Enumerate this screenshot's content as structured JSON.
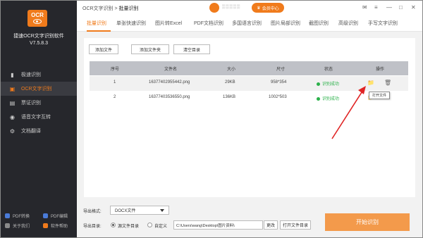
{
  "app": {
    "name": "捷速OCR文字识别软件",
    "version": "V7.5.8.3"
  },
  "sidebar": {
    "items": [
      {
        "label": "极速识别",
        "icon": "bookmark-icon"
      },
      {
        "label": "OCR文字识别",
        "icon": "ocr-icon",
        "active": true
      },
      {
        "label": "票证识别",
        "icon": "ticket-icon"
      },
      {
        "label": "语音文字互转",
        "icon": "voice-icon"
      },
      {
        "label": "文档翻译",
        "icon": "translate-icon"
      }
    ],
    "bottom_links": [
      {
        "label": "PDF转换",
        "color": "#4a7bd8"
      },
      {
        "label": "PDF编辑",
        "color": "#4a7bd8"
      },
      {
        "label": "关于我们",
        "color": "#8a8a8a"
      },
      {
        "label": "软件帮助",
        "color": "#f07b1c"
      }
    ]
  },
  "titlebar": {
    "crumb_root": "OCR文字识别",
    "crumb_sep": " > ",
    "crumb_current": "批量识别",
    "member_label": "会员中心"
  },
  "tabs": [
    "批量识别",
    "单张快速识别",
    "图片转Excel",
    "PDF文档识别",
    "多国语言识别",
    "图片局部识别",
    "截图识别",
    "高级识别",
    "手写文字识别"
  ],
  "toolbar": {
    "add_file": "添加文件",
    "add_folder": "添加文件夹",
    "clear": "清空目录"
  },
  "table": {
    "columns": [
      "序号",
      "文件名",
      "大小",
      "尺寸",
      "状态",
      "操作"
    ],
    "rows": [
      {
        "index": "1",
        "filename": "16377402955442.png",
        "size": "29KB",
        "dims": "958*354",
        "status": "识别成功"
      },
      {
        "index": "2",
        "filename": "16377403536550.png",
        "size": "136KB",
        "dims": "1002*503",
        "status": "识别成功"
      }
    ],
    "tooltip": "打开文件"
  },
  "bottom": {
    "export_label": "导出格式:",
    "export_value": "DOCX文件",
    "outdir_label": "导出目录:",
    "option_source": "源文件目录",
    "option_custom": "自定义",
    "path": "C:\\Users\\wang\\Desktop\\图片资料\\",
    "change": "更改",
    "open_dir": "打开文件目录",
    "start": "开始识别"
  },
  "colors": {
    "accent": "#f07b1c",
    "sidebar_bg": "#26272c",
    "success": "#2bb14a",
    "arrow": "#e02424"
  }
}
